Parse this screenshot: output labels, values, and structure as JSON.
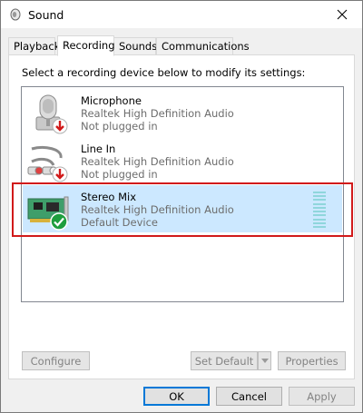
{
  "window": {
    "title": "Sound",
    "icon": "speaker-icon",
    "close_icon": "close-icon"
  },
  "tabs": [
    {
      "label": "Playback",
      "active": false
    },
    {
      "label": "Recording",
      "active": true
    },
    {
      "label": "Sounds",
      "active": false
    },
    {
      "label": "Communications",
      "active": false
    }
  ],
  "instructions": "Select a recording device below to modify its settings:",
  "devices": [
    {
      "name": "Microphone",
      "driver": "Realtek High Definition Audio",
      "status": "Not plugged in",
      "icon": "microphone-icon",
      "badge": "red-down-arrow-icon",
      "selected": false
    },
    {
      "name": "Line In",
      "driver": "Realtek High Definition Audio",
      "status": "Not plugged in",
      "icon": "line-in-cable-icon",
      "badge": "red-down-arrow-icon",
      "selected": false
    },
    {
      "name": "Stereo Mix",
      "driver": "Realtek High Definition Audio",
      "status": "Default Device",
      "icon": "sound-card-icon",
      "badge": "green-check-icon",
      "selected": true
    }
  ],
  "panel_buttons": {
    "configure": "Configure",
    "set_default": "Set Default",
    "properties": "Properties"
  },
  "footer_buttons": {
    "ok": "OK",
    "cancel": "Cancel",
    "apply": "Apply"
  },
  "colors": {
    "selection": "#cce8ff",
    "highlight_border": "#d11a1a",
    "default_button_border": "#0078d7",
    "meter": "#8fd6dc"
  }
}
